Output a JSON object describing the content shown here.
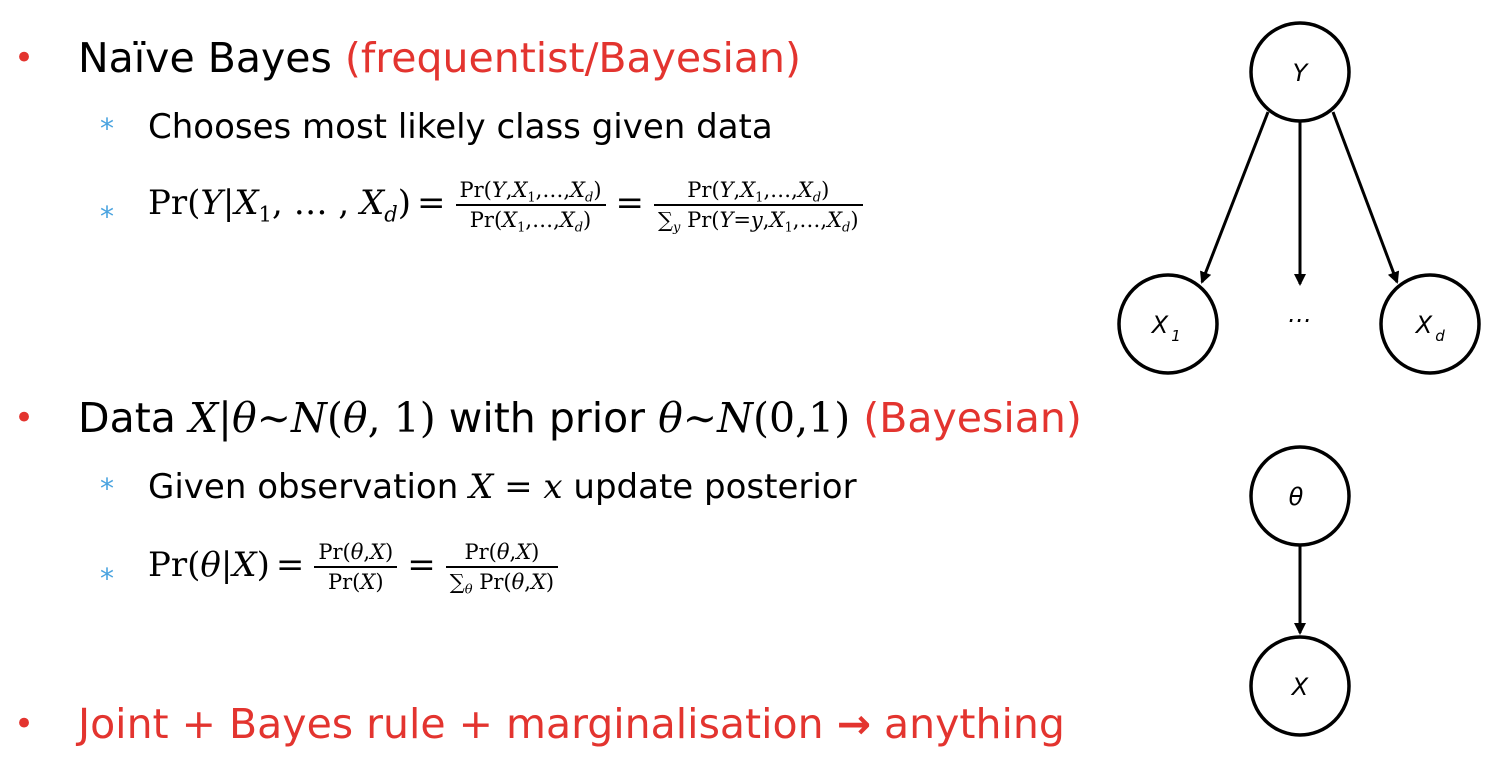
{
  "bullet1": {
    "marker": "•",
    "title": "Naïve Bayes",
    "tag": "(frequentist/Bayesian)",
    "sub1": {
      "marker": "*",
      "text": "Chooses most likely class given data"
    },
    "sub2": {
      "marker": "*",
      "lhs": "Pr(Y|X₁, … , X_d)",
      "f1_num": "Pr(Y,X₁,…,X_d)",
      "f1_den": "Pr(X₁,…,X_d)",
      "f2_num": "Pr(Y,X₁,…,X_d)",
      "f2_den": "∑_y Pr(Y=y,X₁,…,X_d)"
    }
  },
  "bullet2": {
    "marker": "•",
    "prefix": "Data",
    "math1": "X|θ∼N(θ, 1)",
    "middle": "with prior",
    "math2": "θ∼N(0,1)",
    "tag": "(Bayesian)",
    "sub1": {
      "marker": "*",
      "prefix": "Given observation",
      "math": "X = x",
      "suffix": "update posterior"
    },
    "sub2": {
      "marker": "*",
      "lhs": "Pr(θ|X)",
      "f1_num": "Pr(θ,X)",
      "f1_den": "Pr(X)",
      "f2_num": "Pr(θ,X)",
      "f2_den": "∑_θ Pr(θ,X)"
    }
  },
  "bullet3": {
    "marker": "•",
    "text_before": "Joint + Bayes rule + marginalisation",
    "arrow": "→",
    "text_after": "anything"
  },
  "graph1": {
    "nodes": [
      {
        "id": "Y",
        "label": "Y",
        "sub": ""
      },
      {
        "id": "X1",
        "label": "X",
        "sub": "1"
      },
      {
        "id": "Xd",
        "label": "X",
        "sub": "d"
      }
    ],
    "ellipsis": "…",
    "edges": [
      [
        "Y",
        "X1"
      ],
      [
        "Y",
        "ellipsis"
      ],
      [
        "Y",
        "Xd"
      ]
    ]
  },
  "graph2": {
    "nodes": [
      {
        "id": "theta",
        "label": "θ"
      },
      {
        "id": "X",
        "label": "X"
      }
    ],
    "edges": [
      [
        "theta",
        "X"
      ]
    ]
  },
  "colors": {
    "accent_red": "#e3342f",
    "sub_bullet_blue": "#4aa3df",
    "text": "#000000"
  }
}
